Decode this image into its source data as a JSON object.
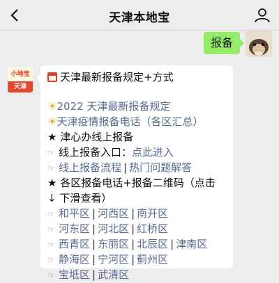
{
  "header": {
    "title": "天津本地宝",
    "back_icon": "chevron-left-icon",
    "user_icon": "person-icon"
  },
  "outgoing": {
    "text": "报备"
  },
  "bot": {
    "avatar_top": "小地宝",
    "avatar_bottom": "天津"
  },
  "message": {
    "heading": "天津最新报备规定+方式",
    "item1": "2022 天津最新报备规定",
    "item2": "天津疫情报备电话（各区汇总）",
    "section1": "津心办线上报备",
    "entry_label": "线上报备入口：",
    "entry_link": "点此进入",
    "flow_link": "线上报备流程",
    "faq_link": "热门问题解答",
    "section2_line1": "各区报备电话+报备二维码（点击",
    "section2_line2": "↓ 下滑查看）",
    "districts": {
      "r1": [
        "和平区",
        "河西区",
        "南开区"
      ],
      "r2": [
        "河东区",
        "河北区",
        "红桥区"
      ],
      "r3": [
        "西青区",
        "东丽区",
        "北辰区",
        "津南区"
      ],
      "r4": [
        "静海区",
        "宁河区",
        "蓟州区"
      ],
      "r5": [
        "宝坻区",
        "武清区"
      ]
    },
    "separator": "|"
  },
  "colors": {
    "link": "#576b95",
    "bubble_out": "#95ec69",
    "background": "#ededed"
  }
}
